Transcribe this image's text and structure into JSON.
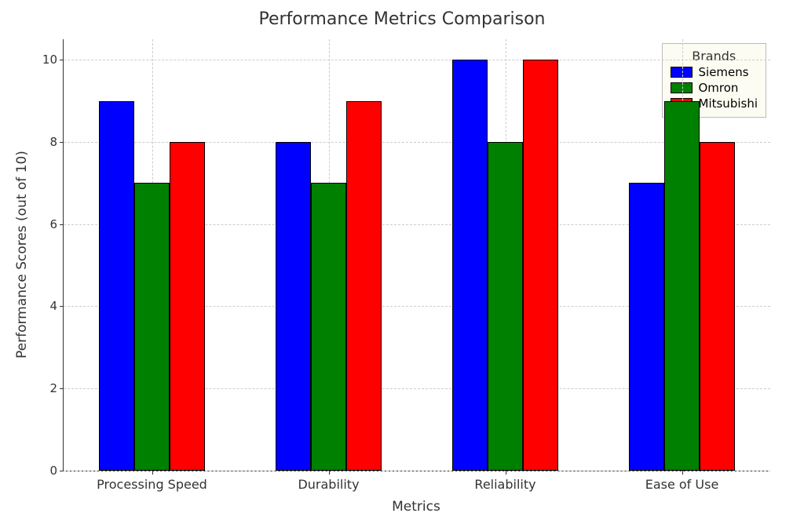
{
  "chart_data": {
    "type": "bar",
    "title": "Performance Metrics Comparison",
    "xlabel": "Metrics",
    "ylabel": "Performance Scores (out of 10)",
    "categories": [
      "Processing Speed",
      "Durability",
      "Reliability",
      "Ease of Use"
    ],
    "series": [
      {
        "name": "Siemens",
        "color": "#0000ff",
        "values": [
          9,
          8,
          10,
          7
        ]
      },
      {
        "name": "Omron",
        "color": "#008000",
        "values": [
          7,
          7,
          8,
          9
        ]
      },
      {
        "name": "Mitsubishi",
        "color": "#ff0000",
        "values": [
          8,
          9,
          10,
          8
        ]
      }
    ],
    "ylim": [
      0,
      10.5
    ],
    "yticks": [
      0,
      2,
      4,
      6,
      8,
      10
    ],
    "legend_title": "Brands",
    "legend_position": "upper right",
    "grid": true
  }
}
